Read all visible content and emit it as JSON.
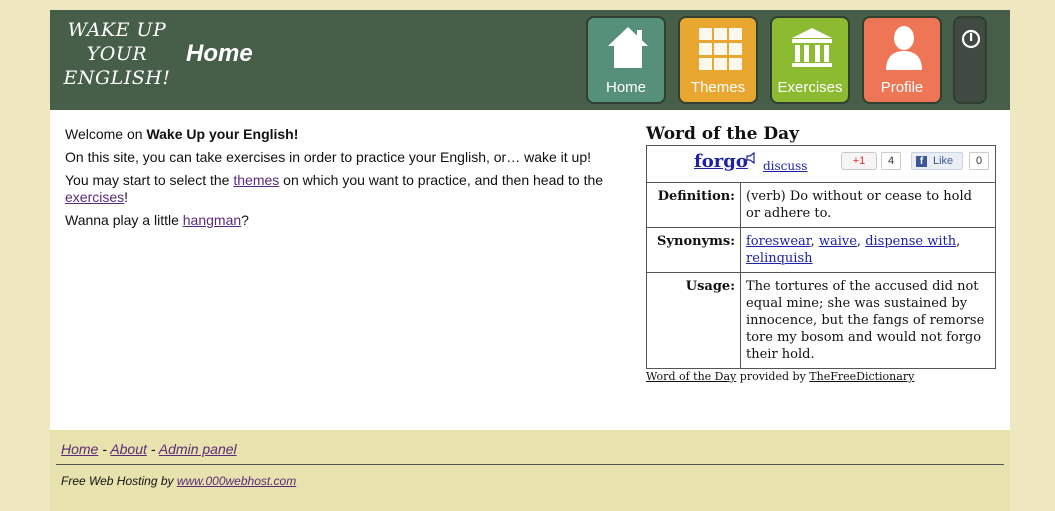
{
  "header": {
    "logo_lines": [
      "WAKE UP",
      "YOUR",
      "ENGLISH!"
    ],
    "page_title": "Home",
    "nav": [
      {
        "label": "Home",
        "icon": "home-icon",
        "color": "#56907b"
      },
      {
        "label": "Themes",
        "icon": "grid-icon",
        "color": "#e8a731"
      },
      {
        "label": "Exercises",
        "icon": "building-icon",
        "color": "#8cbb32"
      },
      {
        "label": "Profile",
        "icon": "user-icon",
        "color": "#ee7656"
      }
    ],
    "power_icon": "power-icon"
  },
  "intro": {
    "welcome_prefix": "Welcome on ",
    "welcome_bold": "Wake Up your English!",
    "line2": "On this site, you can take exercises in order to practice your English, or… wake it up!",
    "line3_a": "You may start to select the ",
    "line3_link1": "themes",
    "line3_b": " on which you want to practice, and then head to the ",
    "line3_link2": "exercises",
    "line3_c": "!",
    "line4_a": "Wanna play a little ",
    "line4_link": "hangman",
    "line4_b": "?"
  },
  "wotd": {
    "title": "Word of the Day",
    "word": "forgo",
    "discuss": "discuss",
    "gplus": "+1",
    "gplus_count": "4",
    "fb_like": "Like",
    "fb_count": "0",
    "definition_label": "Definition:",
    "definition": "(verb) Do without or cease to hold or adhere to.",
    "synonyms_label": "Synonyms:",
    "synonyms": [
      "foreswear",
      "waive",
      "dispense with",
      "relinquish"
    ],
    "usage_label": "Usage:",
    "usage": "The tortures of the accused did not equal mine; she was sustained by innocence, but the fangs of remorse tore my bosom and would not forgo their hold.",
    "credit_link1": "Word of the Day",
    "credit_mid": " provided by ",
    "credit_link2": "TheFreeDictionary"
  },
  "footer": {
    "links": [
      "Home",
      "About",
      "Admin panel"
    ],
    "sep": " - ",
    "host_prefix": "Free Web Hosting by ",
    "host_link": "www.000webhost.com"
  }
}
